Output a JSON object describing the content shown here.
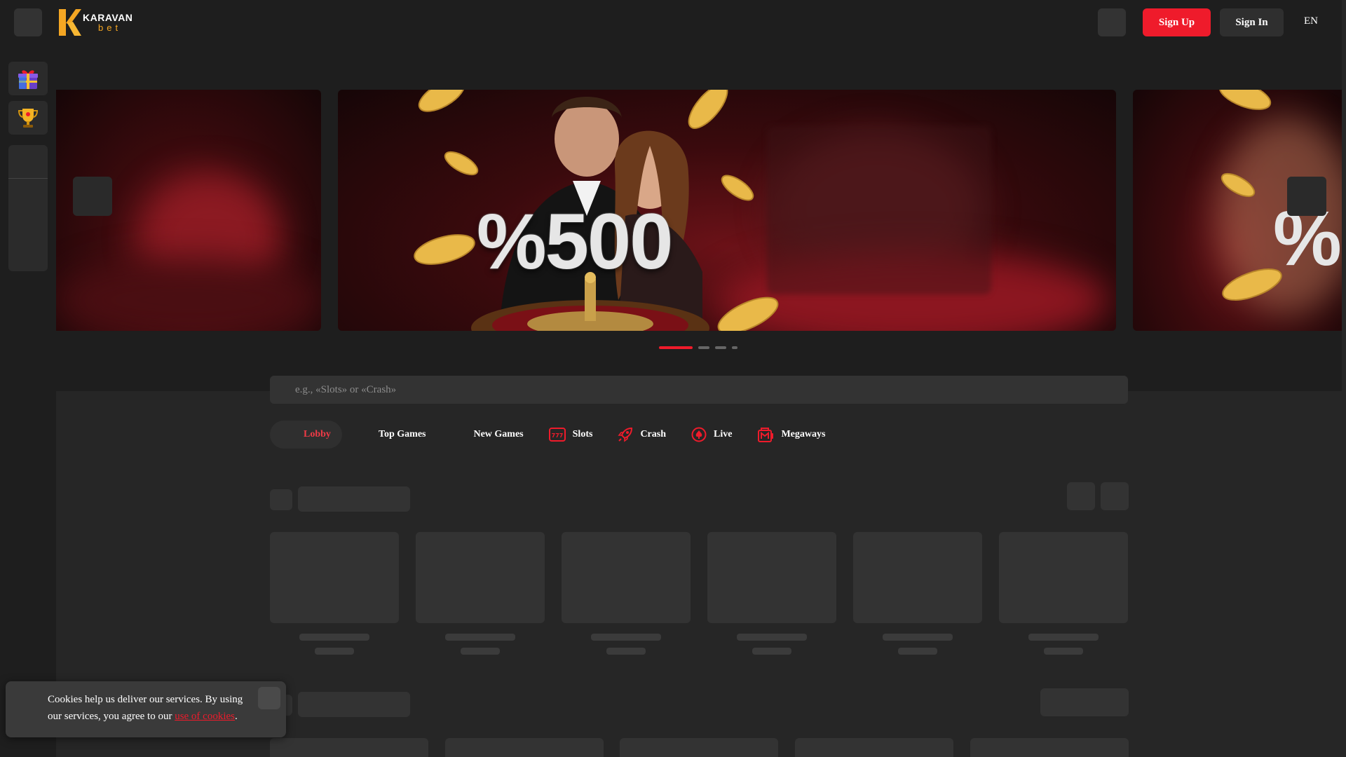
{
  "header": {
    "logo_word": "KARAVAN",
    "logo_sub": "bet",
    "signup_label": "Sign Up",
    "signin_label": "Sign In",
    "language": "EN"
  },
  "banner": {
    "headline": "%500",
    "slide_count": 4,
    "active_slide": 1
  },
  "search": {
    "placeholder": "e.g., «Slots» or «Crash»"
  },
  "tabs": [
    {
      "label": "Lobby",
      "icon": "lobby-icon",
      "active": true
    },
    {
      "label": "Top Games",
      "icon": "top-games-icon"
    },
    {
      "label": "New Games",
      "icon": "new-games-icon"
    },
    {
      "label": "Slots",
      "icon": "slots-777-icon"
    },
    {
      "label": "Crash",
      "icon": "rocket-icon"
    },
    {
      "label": "Live",
      "icon": "live-poker-chip-icon"
    },
    {
      "label": "Megaways",
      "icon": "megaways-icon"
    }
  ],
  "cookie": {
    "text": "Cookies help us deliver our services. By using our services, you agree to our",
    "link": "use of cookies",
    "end": "."
  },
  "colors": {
    "accent": "#ef1b2b",
    "header_bg": "#1e1e1e",
    "page_bg": "#262626",
    "skeleton": "#333333",
    "logo_orange": "#f4a623"
  }
}
